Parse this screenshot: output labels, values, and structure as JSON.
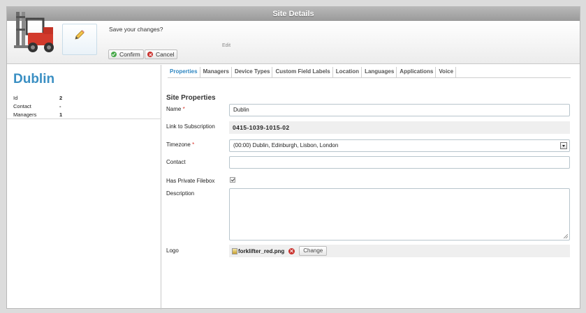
{
  "window": {
    "title": "Site Details"
  },
  "toolbar": {
    "edit_label": "Edit",
    "prompt": "Save your changes?",
    "confirm_label": "Confirm",
    "cancel_label": "Cancel"
  },
  "site": {
    "name": "Dublin",
    "info": [
      {
        "key": "Id",
        "value": "2"
      },
      {
        "key": "Contact",
        "value": "-"
      },
      {
        "key": "Managers",
        "value": "1"
      }
    ]
  },
  "tabs": [
    {
      "label": "Properties",
      "active": true
    },
    {
      "label": "Managers",
      "active": false
    },
    {
      "label": "Device Types",
      "active": false
    },
    {
      "label": "Custom Field Labels",
      "active": false
    },
    {
      "label": "Location",
      "active": false
    },
    {
      "label": "Languages",
      "active": false
    },
    {
      "label": "Applications",
      "active": false
    },
    {
      "label": "Voice",
      "active": false
    }
  ],
  "form": {
    "section_title": "Site Properties",
    "name_label": "Name",
    "name_value": "Dublin",
    "subscription_label": "Link to Subscription",
    "subscription_value": "0415-1039-1015-02",
    "timezone_label": "Timezone",
    "timezone_value": "(00:00) Dublin, Edinburgh, Lisbon, London",
    "contact_label": "Contact",
    "contact_value": "",
    "filebox_label": "Has Private Filebox",
    "filebox_checked": true,
    "description_label": "Description",
    "description_value": "",
    "logo_label": "Logo",
    "logo_filename": "forklifter_red.png",
    "change_label": "Change",
    "required_mark": "*"
  },
  "icons": {
    "logo": "forklift-icon",
    "edit": "pencil-icon",
    "confirm": "check-circle-icon",
    "cancel": "x-circle-icon",
    "file": "image-file-icon",
    "remove": "remove-icon"
  },
  "colors": {
    "title_accent": "#3a8fc3",
    "active_tab": "#2e86c1",
    "required": "#d9342b",
    "confirm": "#47a94a",
    "cancel": "#c9302c"
  }
}
